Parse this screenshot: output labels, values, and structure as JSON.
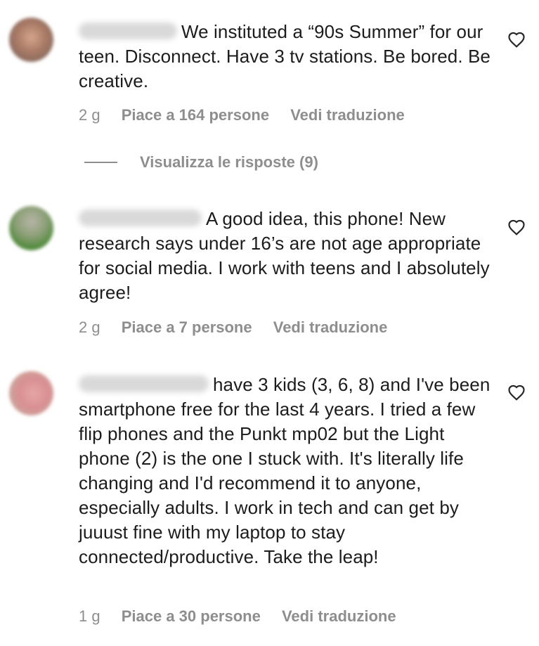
{
  "comments": [
    {
      "text": "We instituted a “90s Summer” for our teen. Disconnect. Have 3 tv stations. Be bored. Be creative.",
      "time": "2 g",
      "likes": "Piace a 164 persone",
      "translate": "Vedi traduzione",
      "avatar_color": "#b98f7a",
      "replies": "Visualizza le risposte (9)"
    },
    {
      "text": "A good idea, this phone! New research says under 16’s are not age appropriate for social media. I work with teens and I absolutely agree!",
      "time": "2 g",
      "likes": "Piace a 7 persone",
      "translate": "Vedi traduzione",
      "avatar_color": "#6f8f55"
    },
    {
      "text": "have 3 kids (3, 6, 8) and I've been smartphone free for the last 4 years. I tried a few flip phones and the Punkt mp02 but the Light phone (2) is the one I stuck with. It's literally life changing and I'd recommend it to anyone, especially adults. I work in tech and can get by juuust fine with my laptop to stay connected/productive. Take the leap!",
      "time": "1 g",
      "likes": "Piace a 30 persone",
      "translate": "Vedi traduzione",
      "avatar_color": "#d89a9a"
    }
  ],
  "icons": {
    "like": "heart-outline-icon"
  },
  "colors": {
    "meta": "#8e8e8e",
    "text": "#1c1c1c"
  }
}
